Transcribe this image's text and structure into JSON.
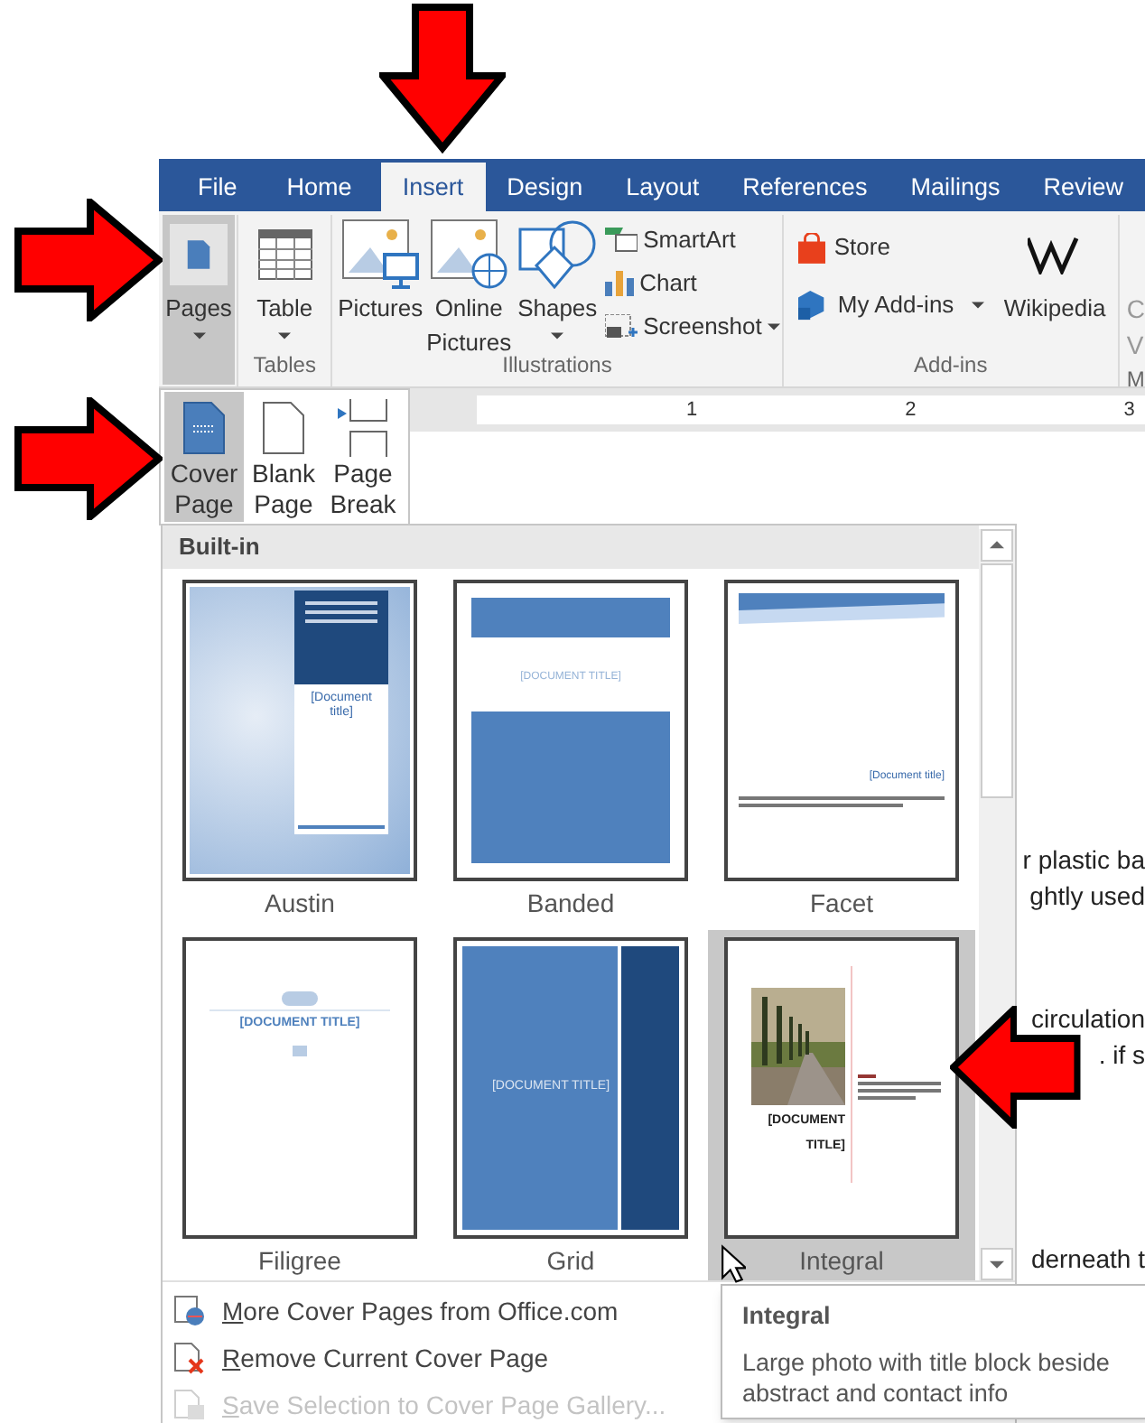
{
  "tabs": [
    {
      "label": "File",
      "selected": false
    },
    {
      "label": "Home",
      "selected": false
    },
    {
      "label": "Insert",
      "selected": true
    },
    {
      "label": "Design",
      "selected": false
    },
    {
      "label": "Layout",
      "selected": false
    },
    {
      "label": "References",
      "selected": false
    },
    {
      "label": "Mailings",
      "selected": false
    },
    {
      "label": "Review",
      "selected": false
    }
  ],
  "ribbon": {
    "pages": {
      "label": "Pages",
      "selected": true
    },
    "tables": {
      "group": "Tables",
      "button": "Table"
    },
    "illustrations": {
      "group": "Illustrations",
      "buttons": [
        "Pictures",
        "Online Pictures",
        "Shapes"
      ],
      "small_buttons": [
        "SmartArt",
        "Chart",
        "Screenshot"
      ]
    },
    "addins": {
      "group": "Add-ins",
      "small_buttons": [
        "Store",
        "My Add-ins"
      ],
      "button": "Wikipedia"
    },
    "cut_group": {
      "group": "M",
      "lines": [
        "C",
        "V"
      ]
    }
  },
  "ruler": {
    "numbers": [
      "1",
      "2",
      "3"
    ]
  },
  "pages_menu": [
    {
      "label": "Cover Page",
      "kind": "cover",
      "selected": true
    },
    {
      "label": "Blank Page",
      "kind": "blank",
      "selected": false
    },
    {
      "label": "Page Break",
      "kind": "break",
      "selected": false
    }
  ],
  "gallery": {
    "section": "Built-in",
    "items": [
      {
        "name": "Austin",
        "kind": "austin",
        "title": "[Document title]",
        "selected": false
      },
      {
        "name": "Banded",
        "kind": "banded",
        "title": "[DOCUMENT TITLE]",
        "selected": false
      },
      {
        "name": "Facet",
        "kind": "facet",
        "title": "[Document title]",
        "selected": false
      },
      {
        "name": "Filigree",
        "kind": "filigree",
        "title": "[DOCUMENT TITLE]",
        "selected": false
      },
      {
        "name": "Grid",
        "kind": "grid",
        "title": "[DOCUMENT TITLE]",
        "selected": false
      },
      {
        "name": "Integral",
        "kind": "integral",
        "title": "[DOCUMENT TITLE]",
        "selected": true
      }
    ],
    "menu": [
      {
        "label": "More Cover Pages from Office.com",
        "kind": "more",
        "disabled": false
      },
      {
        "label": "Remove Current Cover Page",
        "kind": "remove",
        "disabled": false
      },
      {
        "label": "Save Selection to Cover Page Gallery...",
        "kind": "save",
        "disabled": true
      }
    ]
  },
  "tooltip": {
    "title": "Integral",
    "description": "Large photo with title block beside abstract and contact info"
  },
  "document": {
    "paragraphs": [
      {
        "lines": [
          "r plastic ba",
          "ghtly used"
        ]
      },
      {
        "lines": [
          "circulation",
          ". if s"
        ]
      },
      {
        "lines": [
          "derneath t"
        ]
      }
    ]
  }
}
